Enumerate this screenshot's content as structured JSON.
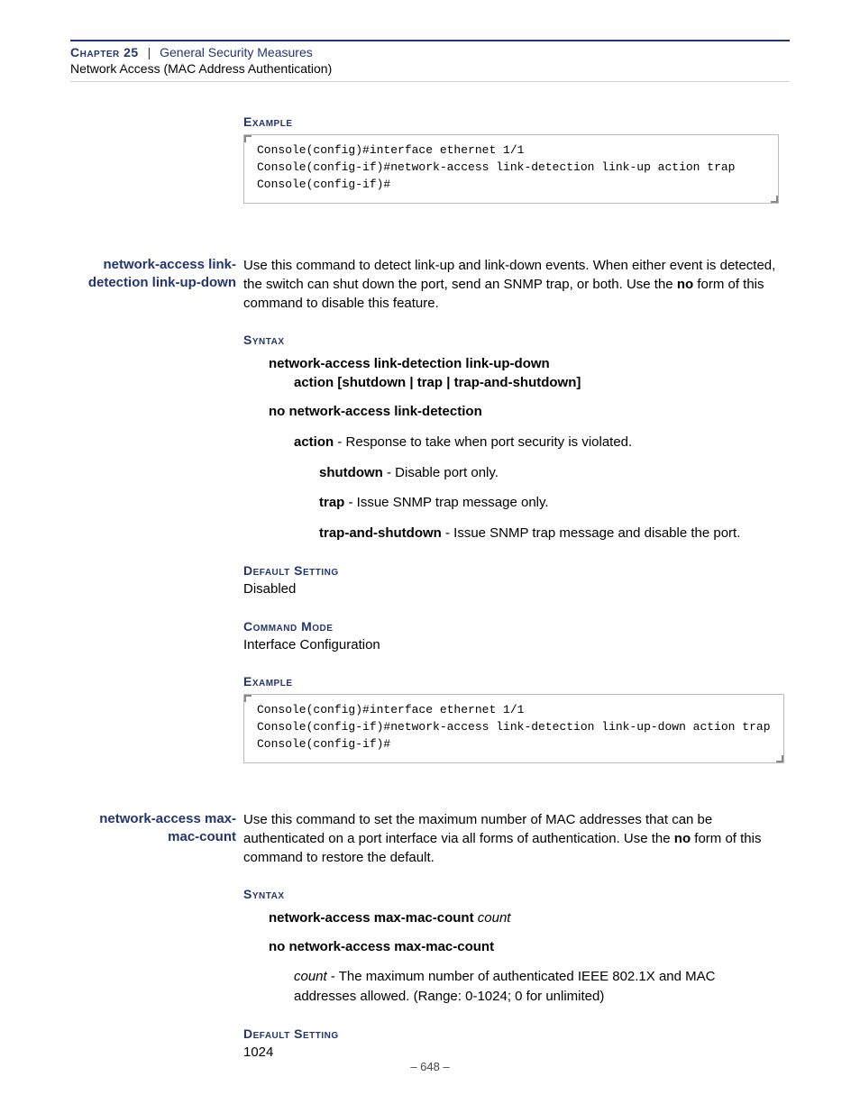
{
  "header": {
    "chapter_label": "Chapter 25",
    "separator": "|",
    "title": "General Security Measures",
    "subtitle": "Network Access (MAC Address Authentication)"
  },
  "sec1": {
    "example_heading": "Example",
    "code": "Console(config)#interface ethernet 1/1\nConsole(config-if)#network-access link-detection link-up action trap\nConsole(config-if)#"
  },
  "sec2": {
    "sidebar": "network-access link-detection link-up-down",
    "intro_pre": "Use this command to detect link-up and link-down events. When either event is detected, the switch can shut down the port, send an SNMP trap, or both. Use the ",
    "intro_bold": "no",
    "intro_post": " form of this command to disable this feature.",
    "syntax_heading": "Syntax",
    "syntax_line1": "network-access link-detection link-up-down",
    "syntax_line2_pre": "action",
    "syntax_line2_opts": " [shutdown | trap | trap-and-shutdown]",
    "syntax_no": "no network-access link-detection",
    "action_label": "action",
    "action_desc": " - Response to take when port security is violated.",
    "opt_shutdown_b": "shutdown",
    "opt_shutdown_t": " - Disable port only.",
    "opt_trap_b": "trap",
    "opt_trap_t": " - Issue SNMP trap message only.",
    "opt_tas_b": "trap-and-shutdown",
    "opt_tas_t": " - Issue SNMP trap message and disable the port.",
    "default_heading": "Default Setting",
    "default_value": "Disabled",
    "mode_heading": "Command Mode",
    "mode_value": "Interface Configuration",
    "example_heading": "Example",
    "code": "Console(config)#interface ethernet 1/1\nConsole(config-if)#network-access link-detection link-up-down action trap\nConsole(config-if)#"
  },
  "sec3": {
    "sidebar": "network-access max-mac-count",
    "intro_pre": "Use this command to set the maximum number of MAC addresses that can be authenticated on a port interface via all forms of authentication. Use the ",
    "intro_bold": "no",
    "intro_post": " form of this command to restore the default.",
    "syntax_heading": "Syntax",
    "syntax_line_b": "network-access max-mac-count ",
    "syntax_line_i": "count",
    "syntax_no": "no network-access max-mac-count",
    "count_i": "count",
    "count_t": " - The maximum number of authenticated IEEE 802.1X and MAC addresses allowed. (Range: 0-1024; 0 for unlimited)",
    "default_heading": "Default Setting",
    "default_value": "1024"
  },
  "footer": {
    "page": "–  648  –"
  }
}
